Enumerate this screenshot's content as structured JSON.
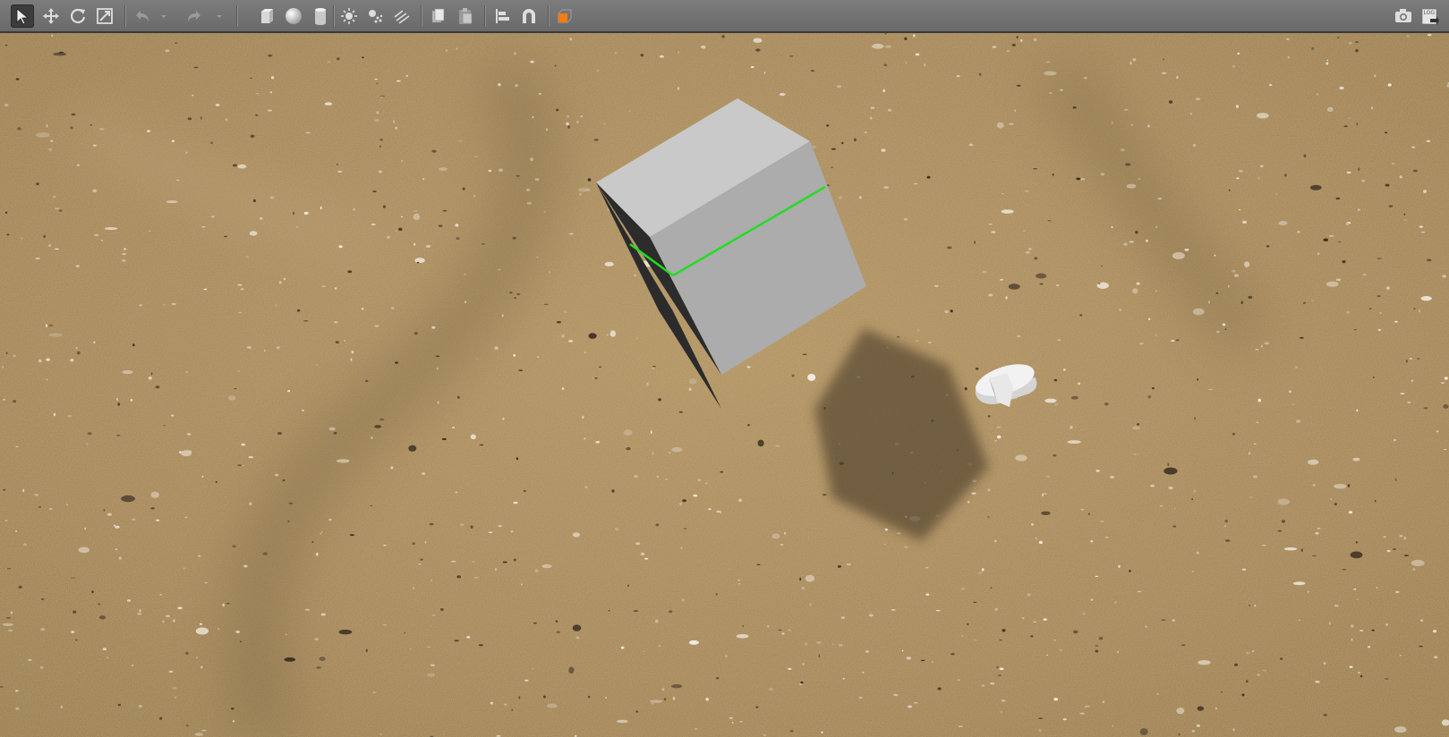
{
  "toolbar": {
    "left_tools": [
      {
        "name": "select-mode-icon",
        "active": true
      },
      {
        "name": "translate-mode-icon"
      },
      {
        "name": "rotate-mode-icon"
      },
      {
        "name": "scale-mode-icon"
      },
      {
        "name": "undo-icon",
        "disabled": true
      },
      {
        "name": "undo-history-dropdown-icon",
        "disabled": true
      },
      {
        "name": "redo-icon",
        "disabled": true
      },
      {
        "name": "redo-history-dropdown-icon",
        "disabled": true
      },
      {
        "name": "box-shape-icon"
      },
      {
        "name": "sphere-shape-icon"
      },
      {
        "name": "cylinder-shape-icon"
      },
      {
        "name": "point-light-icon"
      },
      {
        "name": "spot-light-icon"
      },
      {
        "name": "directional-light-icon"
      },
      {
        "name": "copy-icon"
      },
      {
        "name": "paste-icon"
      },
      {
        "name": "align-icon"
      },
      {
        "name": "snap-magnet-icon"
      },
      {
        "name": "view-angle-icon"
      }
    ],
    "right_tools": [
      {
        "name": "screenshot-camera-icon"
      },
      {
        "name": "log-icon",
        "label": "LOG"
      }
    ]
  },
  "colors": {
    "toolbar_bg": "#737373",
    "sand": "#9c8462",
    "highlight": "#e8731a",
    "selection_line": "#22dd22"
  }
}
